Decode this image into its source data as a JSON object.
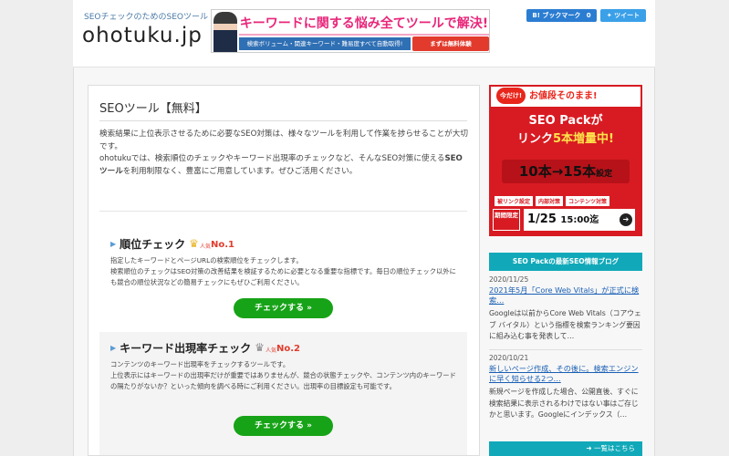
{
  "header": {
    "tagline": "SEOチェックのためのSEOツール",
    "logo": "ohotuku.jp",
    "banner": {
      "title": "キーワードに関する悩み全てツールで解決!",
      "subtitle": "検索ボリューム・関連キーワード・難易度すべて自動取得!",
      "cta": "まずは無料体験"
    },
    "share": {
      "hatena_label": "B! ブックマーク",
      "hatena_count": "0",
      "tweet_label": "ツイート"
    }
  },
  "main": {
    "title": "SEOツール【無料】",
    "intro_p1": "検索結果に上位表示させるために必要なSEO対策は、様々なツールを利用して作業を捗らせることが大切です。",
    "intro_p2_a": "ohotukuでは、検索順位のチェックやキーワード出現率のチェックなど、そんなSEO対策に使える",
    "intro_p2_bold": "SEOツール",
    "intro_p2_b": "を利用制限なく、豊富にご用意しています。ぜひご活用ください。",
    "tools": [
      {
        "name": "順位チェック",
        "badge_text": "人気",
        "badge_num": "No.1",
        "desc1": "指定したキーワードとページURLの検索順位をチェックします。",
        "desc2": "検索順位のチェックはSEO対策の改善結果を検証するために必要となる重要な指標です。毎日の順位チェック以外にも競合の順位状況などの簡易チェックにもぜひご利用ください。",
        "button": "チェックする »"
      },
      {
        "name": "キーワード出現率チェック",
        "badge_text": "人気",
        "badge_num": "No.2",
        "desc1": "コンテンツのキーワード出現率をチェックするツールです。",
        "desc2": "上位表示にはキーワードの出現率だけが重要ではありませんが、競合の状態チェックや、コンテンツ内のキーワードの隔たりがないか？といった傾向を調べる時にご利用ください。出現率の目標設定も可能です。",
        "button": "チェックする »"
      }
    ]
  },
  "sidebar": {
    "ad": {
      "badge": "今だけ!",
      "deal": "お値段そのまま!",
      "headline_1": "SEO Packが",
      "headline_2a": "リンク",
      "headline_2b": "5本増量中!",
      "count": "10本→15本",
      "count_suffix": "設定",
      "tags": [
        "被リンク設定",
        "内部対策",
        "コンテンツ対策"
      ],
      "limit": "期間限定",
      "date": "1/25",
      "time": "15:00迄"
    },
    "blog_header": "SEO Packの最新SEO情報ブログ",
    "posts": [
      {
        "date": "2020/11/25",
        "title": "2021年5月「Core Web Vitals」が正式に検索…",
        "excerpt": "Googleは以前からCore Web Vitals（コアウェブ バイタル）という指標を検索ランキング要因に組み込む事を発表して…"
      },
      {
        "date": "2020/10/21",
        "title": "新しいページ作成、その後に。検索エンジンに早く知らせる2つ…",
        "excerpt": "新規ページを作成した場合、公開直後、すぐに検索結果に表示されるわけではない事はご存じかと思います。Googleにインデックス（…"
      }
    ],
    "more": "一覧はこちら"
  },
  "colors": {
    "accent_green": "#17a317",
    "blog_teal": "#11a9b9",
    "ad_red": "#d81b22",
    "link_blue": "#1a5fb4"
  }
}
